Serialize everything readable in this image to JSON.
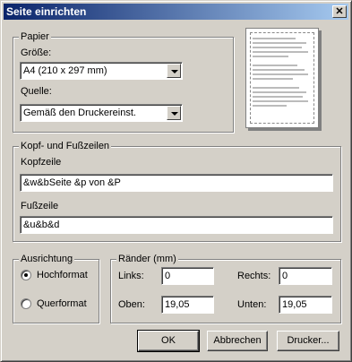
{
  "window": {
    "title": "Seite einrichten",
    "close_glyph": "✕"
  },
  "paper": {
    "legend": "Papier",
    "size_label": "Größe:",
    "size_value": "A4 (210 x 297 mm)",
    "source_label": "Quelle:",
    "source_value": "Gemäß den Druckereinst."
  },
  "headers": {
    "legend": "Kopf- und Fußzeilen",
    "header_label": "Kopfzeile",
    "header_value": "&w&bSeite &p von &P",
    "footer_label": "Fußzeile",
    "footer_value": "&u&b&d"
  },
  "orientation": {
    "legend": "Ausrichtung",
    "portrait": "Hochformat",
    "landscape": "Querformat",
    "selected": "portrait"
  },
  "margins": {
    "legend": "Ränder (mm)",
    "left_label": "Links:",
    "left_value": "0",
    "right_label": "Rechts:",
    "right_value": "0",
    "top_label": "Oben:",
    "top_value": "19,05",
    "bottom_label": "Unten:",
    "bottom_value": "19,05"
  },
  "buttons": {
    "ok": "OK",
    "cancel": "Abbrechen",
    "printer": "Drucker..."
  }
}
